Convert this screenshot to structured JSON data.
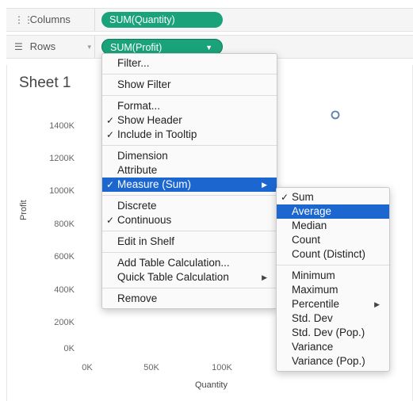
{
  "shelves": {
    "columns": {
      "label": "Columns",
      "pill": "SUM(Quantity)"
    },
    "rows": {
      "label": "Rows",
      "pill": "SUM(Profit)"
    }
  },
  "sheet": {
    "title": "Sheet 1",
    "y_axis_title": "Profit",
    "x_axis_title": "Quantity",
    "y_ticks": [
      "1400K",
      "1200K",
      "1000K",
      "800K",
      "600K",
      "400K",
      "200K",
      "0K"
    ],
    "x_ticks": [
      "0K",
      "50K",
      "100K"
    ]
  },
  "context_menu": {
    "groups": [
      [
        {
          "label": "Filter...",
          "checked": false
        }
      ],
      [
        {
          "label": "Show Filter",
          "checked": false
        }
      ],
      [
        {
          "label": "Format...",
          "checked": false
        },
        {
          "label": "Show Header",
          "checked": true
        },
        {
          "label": "Include in Tooltip",
          "checked": true
        }
      ],
      [
        {
          "label": "Dimension",
          "checked": false
        },
        {
          "label": "Attribute",
          "checked": false
        },
        {
          "label": "Measure (Sum)",
          "checked": true,
          "submenu": true,
          "highlighted": true
        }
      ],
      [
        {
          "label": "Discrete",
          "checked": false
        },
        {
          "label": "Continuous",
          "checked": true
        }
      ],
      [
        {
          "label": "Edit in Shelf",
          "checked": false
        }
      ],
      [
        {
          "label": "Add Table Calculation...",
          "checked": false
        },
        {
          "label": "Quick Table Calculation",
          "checked": false,
          "submenu": true
        }
      ],
      [
        {
          "label": "Remove",
          "checked": false
        }
      ]
    ]
  },
  "measure_submenu": {
    "groups": [
      [
        {
          "label": "Sum",
          "checked": true
        },
        {
          "label": "Average",
          "checked": false,
          "highlighted": true
        },
        {
          "label": "Median",
          "checked": false
        },
        {
          "label": "Count",
          "checked": false
        },
        {
          "label": "Count (Distinct)",
          "checked": false
        }
      ],
      [
        {
          "label": "Minimum",
          "checked": false
        },
        {
          "label": "Maximum",
          "checked": false
        },
        {
          "label": "Percentile",
          "checked": false,
          "submenu": true
        },
        {
          "label": "Std. Dev",
          "checked": false
        },
        {
          "label": "Std. Dev (Pop.)",
          "checked": false
        },
        {
          "label": "Variance",
          "checked": false
        },
        {
          "label": "Variance (Pop.)",
          "checked": false
        }
      ]
    ]
  },
  "colors": {
    "pill": "#1aa37a",
    "highlight": "#1c66d0",
    "mark": "#5b7fae"
  }
}
